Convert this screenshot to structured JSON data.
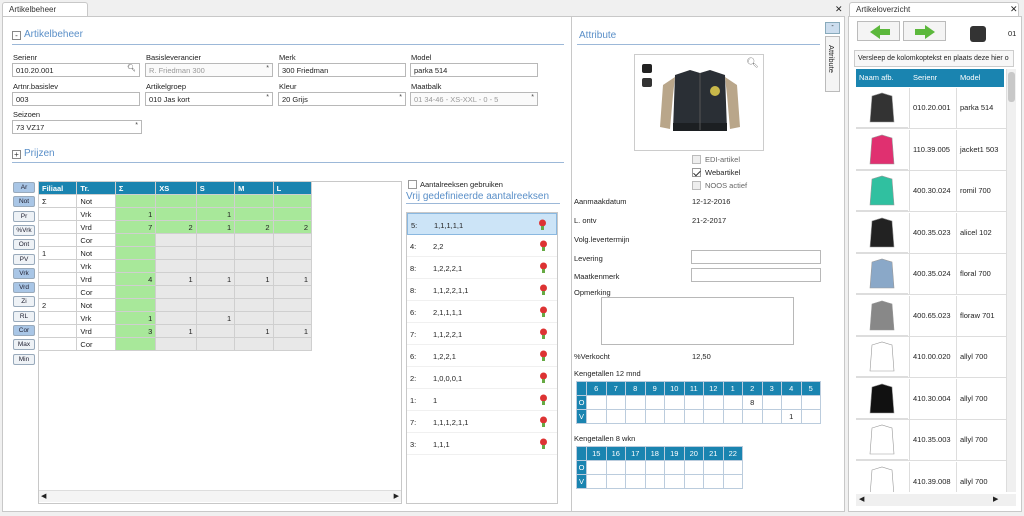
{
  "tabs": {
    "left": "Artikelbeheer",
    "right": "Artikeloverzicht"
  },
  "artikel": {
    "title": "Artikelbeheer",
    "serienr": {
      "label": "Serienr",
      "value": "010.20.001"
    },
    "basisleverancier": {
      "label": "Basisleverancier",
      "value": "R. Friedman 300"
    },
    "merk": {
      "label": "Merk",
      "value": "300 Friedman"
    },
    "model": {
      "label": "Model",
      "value": "parka 514"
    },
    "artnr": {
      "label": "Artnr.basislev",
      "value": "003"
    },
    "artikelgroep": {
      "label": "Artikelgroep",
      "value": "010 Jas kort"
    },
    "kleur": {
      "label": "Kleur",
      "value": "20 Grijs"
    },
    "maatbalk": {
      "label": "Maatbalk",
      "value": "01 34-46 - XS-XXL - 0 - 5"
    },
    "seizoen": {
      "label": "Seizoen",
      "value": "73 VZ17"
    }
  },
  "prijzen": {
    "title": "Prijzen"
  },
  "side_buttons": [
    "Ar",
    "Not",
    "Pr",
    "%Vrk",
    "Ont",
    "PV",
    "Vrk",
    "Vrd",
    "Zi",
    "RL",
    "Cor",
    "Max",
    "Min"
  ],
  "grid": {
    "headers": [
      "Filiaal",
      "Tr.",
      "Σ",
      "XS",
      "S",
      "M",
      "L"
    ],
    "rows": [
      [
        "Σ",
        "Not",
        "",
        "",
        "",
        "",
        ""
      ],
      [
        "",
        "Vrk",
        "1",
        "",
        "1",
        "",
        ""
      ],
      [
        "",
        "Vrd",
        "7",
        "2",
        "1",
        "2",
        "2"
      ],
      [
        "",
        "Cor",
        "",
        "",
        "",
        "",
        ""
      ],
      [
        "1",
        "Not",
        "",
        "",
        "",
        "",
        ""
      ],
      [
        "",
        "Vrk",
        "",
        "",
        "",
        "",
        ""
      ],
      [
        "",
        "Vrd",
        "4",
        "1",
        "1",
        "1",
        "1"
      ],
      [
        "",
        "Cor",
        "",
        "",
        "",
        "",
        ""
      ],
      [
        "2",
        "Not",
        "",
        "",
        "",
        "",
        ""
      ],
      [
        "",
        "Vrk",
        "1",
        "",
        "1",
        "",
        ""
      ],
      [
        "",
        "Vrd",
        "3",
        "1",
        "",
        "1",
        "1"
      ],
      [
        "",
        "Cor",
        "",
        "",
        "",
        "",
        ""
      ]
    ]
  },
  "aantal": {
    "checkbox_label": "Aantalreeksen gebruiken",
    "title": "Vrij gedefinieerde aantalreeksen",
    "items": [
      {
        "k": "5:",
        "v": "1,1,1,1,1"
      },
      {
        "k": "4:",
        "v": "2,2"
      },
      {
        "k": "8:",
        "v": "1,2,2,2,1"
      },
      {
        "k": "8:",
        "v": "1,1,2,2,1,1"
      },
      {
        "k": "6:",
        "v": "2,1,1,1,1"
      },
      {
        "k": "7:",
        "v": "1,1,2,2,1"
      },
      {
        "k": "6:",
        "v": "1,2,2,1"
      },
      {
        "k": "2:",
        "v": "1,0,0,0,1"
      },
      {
        "k": "1:",
        "v": "1"
      },
      {
        "k": "7:",
        "v": "1,1,1,2,1,1"
      },
      {
        "k": "3:",
        "v": "1,1,1"
      }
    ]
  },
  "attribute": {
    "title": "Attribute",
    "vertical_tab": "Attribute",
    "edi": "EDI-artikel",
    "web": "Webartikel",
    "noos": "NOOS actief",
    "aanmaakdatum": {
      "label": "Aanmaakdatum",
      "value": "12-12-2016"
    },
    "lontv": {
      "label": "L. ontv",
      "value": "21-2-2017"
    },
    "volg": {
      "label": "Volg.levertermijn"
    },
    "levering": {
      "label": "Levering"
    },
    "maatkenmerk": {
      "label": "Maatkenmerk"
    },
    "opmerking": {
      "label": "Opmerking"
    },
    "verkocht": {
      "label": "%Verkocht",
      "value": "12,50"
    },
    "k12": {
      "label": "Kengetallen 12 mnd",
      "months": [
        "6",
        "7",
        "8",
        "9",
        "10",
        "11",
        "12",
        "1",
        "2",
        "3",
        "4",
        "5"
      ],
      "O": [
        "",
        "",
        "",
        "",
        "",
        "",
        "",
        "",
        "8",
        "",
        "",
        ""
      ],
      "V": [
        "",
        "",
        "",
        "",
        "",
        "",
        "",
        "",
        "",
        "",
        "1",
        ""
      ]
    },
    "k8": {
      "label": "Kengetallen 8 wkn",
      "weeks": [
        "15",
        "16",
        "17",
        "18",
        "19",
        "20",
        "21",
        "22"
      ]
    }
  },
  "overzicht": {
    "hint": "Versleep de kolomkoptekst en plaats deze hier o",
    "page_num": "01",
    "headers": [
      "Naam afb.",
      "Serienr",
      "Model"
    ],
    "rows": [
      {
        "serie": "010.20.001",
        "model": "parka 514"
      },
      {
        "serie": "110.39.005",
        "model": "jacket1 503"
      },
      {
        "serie": "400.30.024",
        "model": "romil 700"
      },
      {
        "serie": "400.35.023",
        "model": "alicel 102"
      },
      {
        "serie": "400.35.024",
        "model": "floral 700"
      },
      {
        "serie": "400.65.023",
        "model": "floraw 701"
      },
      {
        "serie": "410.00.020",
        "model": "allyl 700"
      },
      {
        "serie": "410.30.004",
        "model": "allyl 700"
      },
      {
        "serie": "410.35.003",
        "model": "allyl 700"
      },
      {
        "serie": "410.39.008",
        "model": "allyl 700"
      }
    ]
  }
}
